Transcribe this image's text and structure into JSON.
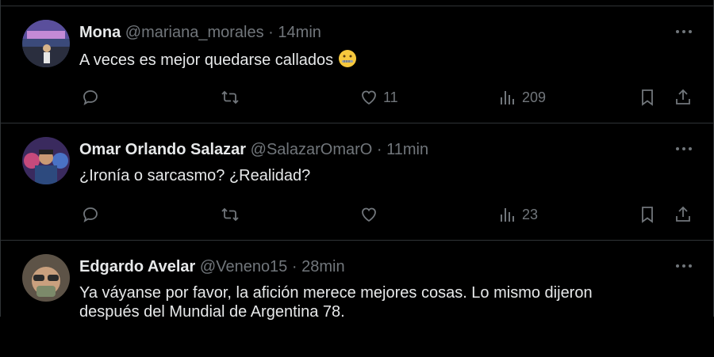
{
  "tweets": [
    {
      "name": "Mona",
      "handle": "@mariana_morales",
      "separator": "·",
      "time": "14min",
      "text": "A veces es mejor quedarse callados",
      "emoji": "zipper-mouth-face",
      "replies": "",
      "retweets": "",
      "likes": "11",
      "views": "209"
    },
    {
      "name": "Omar Orlando Salazar",
      "handle": "@SalazarOmarO",
      "separator": "·",
      "time": "11min",
      "text": "¿Ironía o sarcasmo? ¿Realidad?",
      "replies": "",
      "retweets": "",
      "likes": "",
      "views": "23"
    },
    {
      "name": "Edgardo Avelar",
      "handle": "@Veneno15",
      "separator": "·",
      "time": "28min",
      "text": "Ya váyanse por favor, la afición merece mejores cosas. Lo mismo dijeron",
      "text2": "después del Mundial de Argentina 78."
    }
  ],
  "colors": {
    "background": "#000000",
    "text": "#e7e9ea",
    "muted": "#71767b",
    "border": "#2f3336"
  }
}
